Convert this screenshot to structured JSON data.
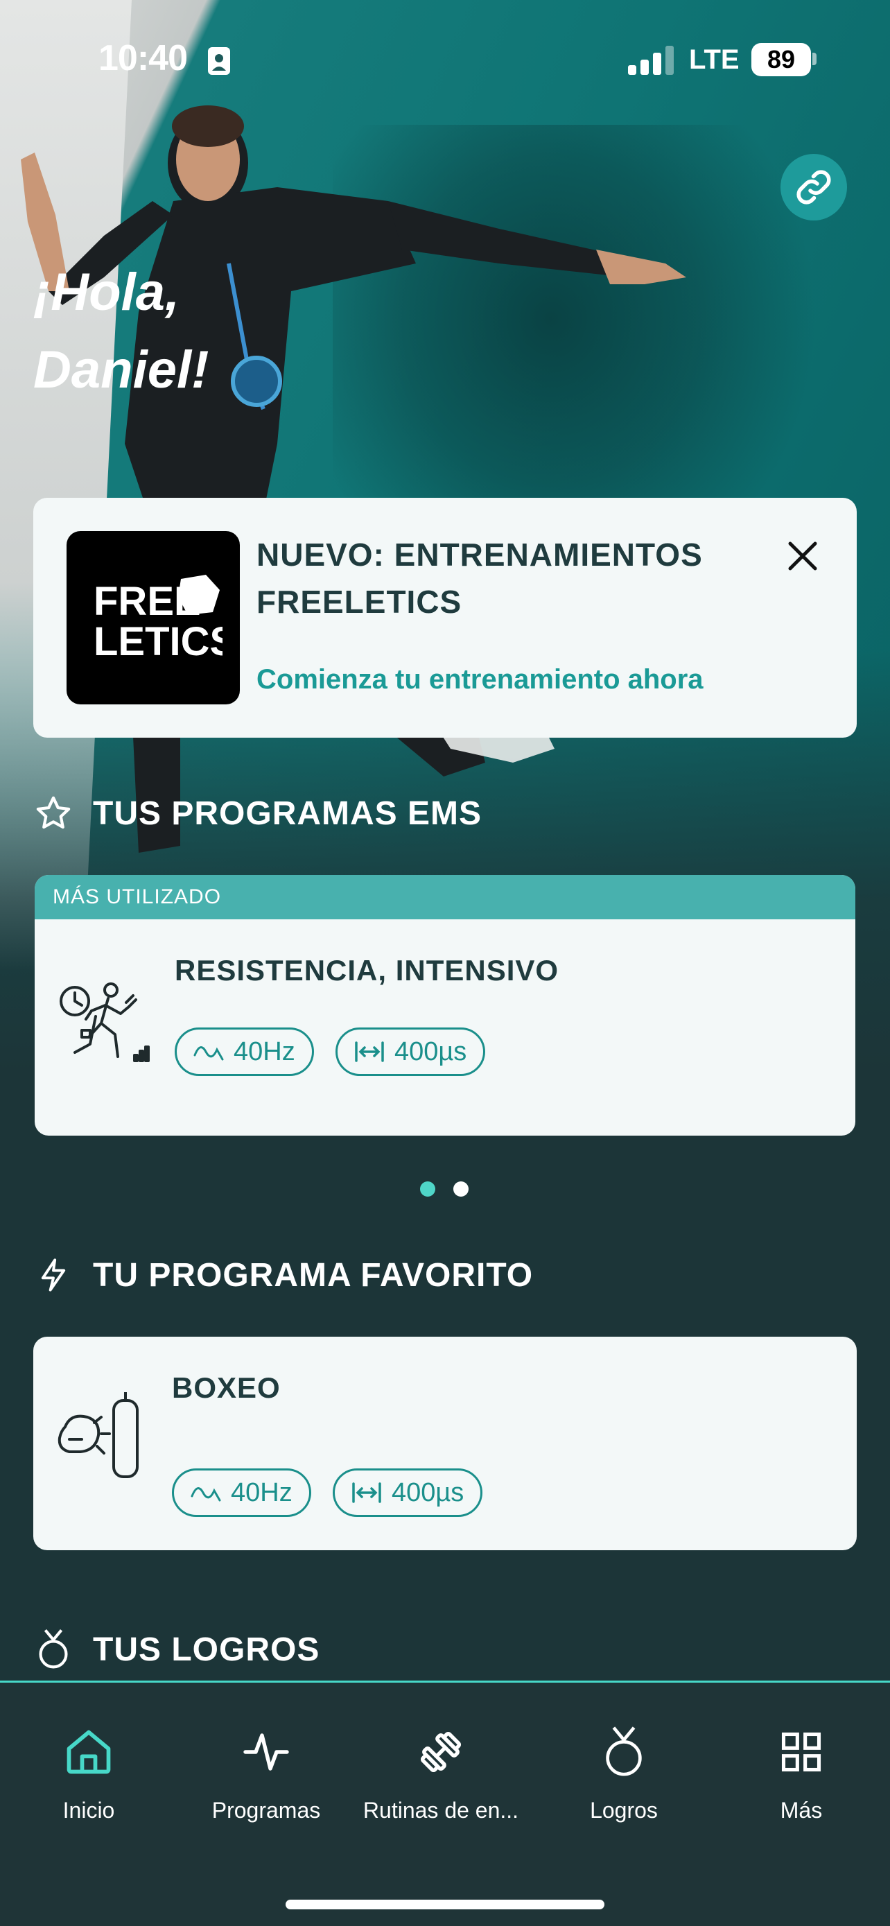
{
  "status_bar": {
    "time": "10:40",
    "network": "LTE",
    "battery": "89"
  },
  "header": {
    "greeting": "¡Hola,\nDaniel!",
    "link_icon": "link-icon"
  },
  "promo": {
    "logo_text_line1": "FREE",
    "logo_text_line2": "LETICS",
    "title": "NUEVO: ENTRENAMIENTOS FREELETICS",
    "cta": "Comienza tu entrenamiento ahora",
    "close_icon": "close-icon"
  },
  "ems_section": {
    "title": "TUS PROGRAMAS EMS",
    "icon": "star-icon",
    "card": {
      "band_label": "MÁS UTILIZADO",
      "name": "RESISTENCIA, INTENSIVO",
      "frequency": "40Hz",
      "pulse_width": "400µs",
      "icon": "endurance-runner-icon"
    },
    "carousel": {
      "pages": 2,
      "active_page": 1
    }
  },
  "favorite_section": {
    "title": "TU PROGRAMA FAVORITO",
    "icon": "lightning-icon",
    "card": {
      "name": "BOXEO",
      "frequency": "40Hz",
      "pulse_width": "400µs",
      "icon": "boxing-glove-icon"
    }
  },
  "achievements_section": {
    "title": "TUS LOGROS",
    "icon": "medal-icon"
  },
  "bottom_nav": {
    "items": [
      {
        "label": "Inicio",
        "icon": "home-icon",
        "active": true
      },
      {
        "label": "Programas",
        "icon": "pulse-icon",
        "active": false
      },
      {
        "label": "Rutinas de en...",
        "icon": "dumbbell-icon",
        "active": false
      },
      {
        "label": "Logros",
        "icon": "medal-icon",
        "active": false
      },
      {
        "label": "Más",
        "icon": "grid-icon",
        "active": false
      }
    ]
  },
  "colors": {
    "accent": "#1a9a96",
    "accent_light": "#47d8c8",
    "band": "#48b1ae",
    "background": "#1c3538",
    "card": "#f3f8f8",
    "text_dark": "#1f3b3e"
  }
}
